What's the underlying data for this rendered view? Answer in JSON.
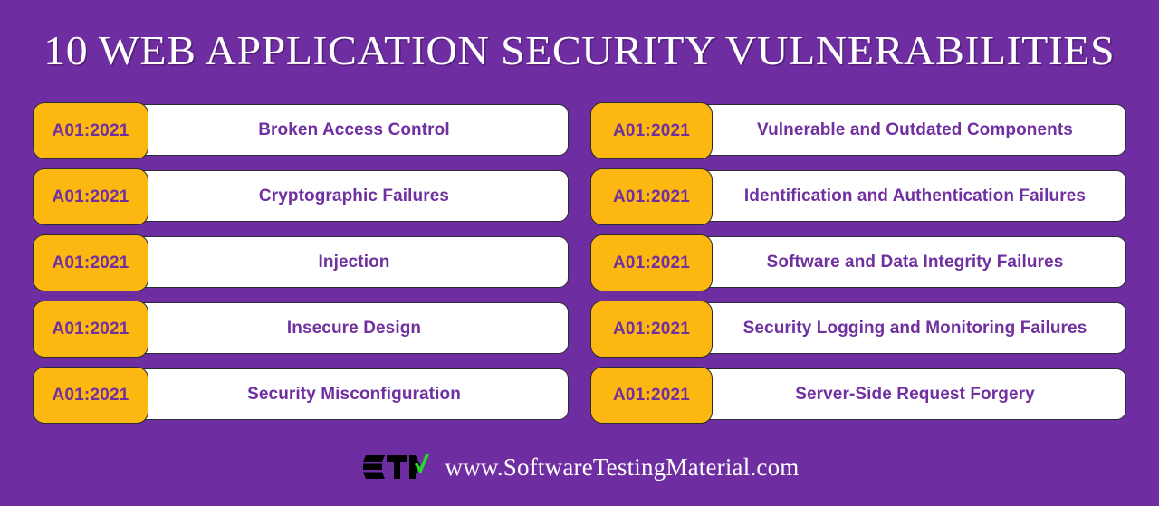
{
  "page": {
    "title": "10 WEB APPLICATION SECURITY VULNERABILITIES",
    "background_color": "#6F2DA2",
    "badge_color": "#FCB711",
    "text_purple": "#7030A0",
    "pill_color": "#FFFFFF",
    "logo_check_color": "#22DD22"
  },
  "columns": {
    "left": [
      {
        "code": "A01:2021",
        "name": "Broken Access Control"
      },
      {
        "code": "A01:2021",
        "name": "Cryptographic Failures"
      },
      {
        "code": "A01:2021",
        "name": "Injection"
      },
      {
        "code": "A01:2021",
        "name": "Insecure Design"
      },
      {
        "code": "A01:2021",
        "name": "Security Misconfiguration"
      }
    ],
    "right": [
      {
        "code": "A01:2021",
        "name": "Vulnerable and Outdated Components"
      },
      {
        "code": "A01:2021",
        "name": "Identification and Authentication Failures"
      },
      {
        "code": "A01:2021",
        "name": "Software and Data Integrity Failures"
      },
      {
        "code": "A01:2021",
        "name": "Security Logging and Monitoring Failures"
      },
      {
        "code": "A01:2021",
        "name": "Server-Side Request Forgery"
      }
    ]
  },
  "footer": {
    "logo_text": "STM",
    "url": "www.SoftwareTestingMaterial.com"
  }
}
